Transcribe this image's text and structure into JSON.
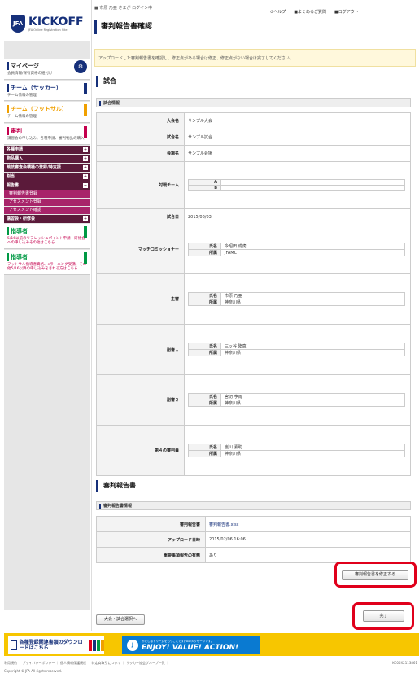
{
  "brand": {
    "logo_text": "KICKOFF",
    "logo_sub": "JFA Online Registration Site"
  },
  "header": {
    "user_line": "市原 乃亜 さまが ログイン中",
    "help": "ヘルプ",
    "faq": "よくあるご質問",
    "logout": "ログアウト",
    "page_title": "審判報告書確認"
  },
  "notice": "アップロードした審判報告書を確認し、修正点がある場合は修正、修正点がない場合は完了してください。",
  "sidebar": {
    "mypage": {
      "title": "マイページ",
      "sub": "会員情報/保有資格の紐付け"
    },
    "soccer": {
      "title": "チーム（サッカー）",
      "sub": "チーム情報の管理"
    },
    "futsal": {
      "title": "チーム（フットサル）",
      "sub": "チーム情報の管理"
    },
    "referee": {
      "title": "審判",
      "sub": "講習会の申し込み、各種申請、審判物品の購入"
    },
    "menu": [
      {
        "label": "各種申請",
        "pm": "+"
      },
      {
        "label": "物品購入",
        "pm": "+"
      },
      {
        "label": "競技審査会積極の登録/特支援",
        "pm": "+"
      },
      {
        "label": "割当",
        "pm": "+"
      },
      {
        "label": "報告書",
        "pm": "−"
      }
    ],
    "report_sub": [
      "審判報告書登録",
      "アセスメント登録",
      "アセスメント確認"
    ],
    "menu2": {
      "label": "講習会・研修会",
      "pm": "+"
    },
    "coach1": {
      "title": "指導者",
      "sub": "5/16以前のリフレッシュポイント申請・研修会への申し込みその他はこちら"
    },
    "coach2": {
      "title": "指導者",
      "sub": "フットサル指導者資格、eラーニング受講、その他5/16以降の申し込みをされる方はこちら"
    }
  },
  "match": {
    "section_title": "試合",
    "sub_title": "試合情報",
    "tournament_label": "大会名",
    "tournament": "サンプル大会",
    "match_label": "試合名",
    "match": "サンプル試合",
    "venue_label": "会場名",
    "venue": "サンプル会場",
    "teams_label": "対戦チーム",
    "team_a": "A",
    "team_b": "B",
    "date_label": "試合日",
    "date": "2015/06/03",
    "commissioner_label": "マッチコミッショナー",
    "referee_label": "主審",
    "ar1_label": "副審１",
    "ar2_label": "副審２",
    "fourth_label": "第４の審判員",
    "name_label": "氏名",
    "affil_label": "所属",
    "commissioner": {
      "name": "今昭田 成虎",
      "affil": "JFAMC"
    },
    "referee": {
      "name": "市原 乃亜",
      "affil": "神奈川県"
    },
    "ar1": {
      "name": "三ッ谷 陸真",
      "affil": "神奈川県"
    },
    "ar2": {
      "name": "宮切 亨雨",
      "affil": "神奈川県"
    },
    "fourth": {
      "name": "嵐川 素助",
      "affil": "神奈川県"
    }
  },
  "report": {
    "section_title": "審判報告書",
    "sub_title": "審判報告書情報",
    "file_label": "審判報告書",
    "file": "審判報告書.xlsx",
    "upload_label": "アップロード日時",
    "upload": "2015/02/06 16:06",
    "special_label": "重要事項報告の有無",
    "special": "あり"
  },
  "buttons": {
    "fix": "審判報告書を修正する",
    "back": "大会・試合選択へ",
    "complete": "完了"
  },
  "banners": {
    "download": "各種登録関連書類のダウンロードはこちら",
    "enjoy_small": "わたしはドリームをもつことですJFAのメッセージです。",
    "enjoy_big": "ENJOY! VALUE! ACTION!"
  },
  "footer": {
    "links": "利用規約 ｜ プライバシーポリシー ｜ 個人情報保護規程 ｜ 特定商取引について ｜ サッカー協会グループ一覧 ｜",
    "copyright": "Copyright © JFA All rights reserved.",
    "version": "KC00X2113861"
  },
  "colors": {
    "brand": "#16307a",
    "referee": "#c4004d",
    "menu": "#5b1a3a",
    "highlight": "#e0001b",
    "banner": "#f7c600"
  }
}
